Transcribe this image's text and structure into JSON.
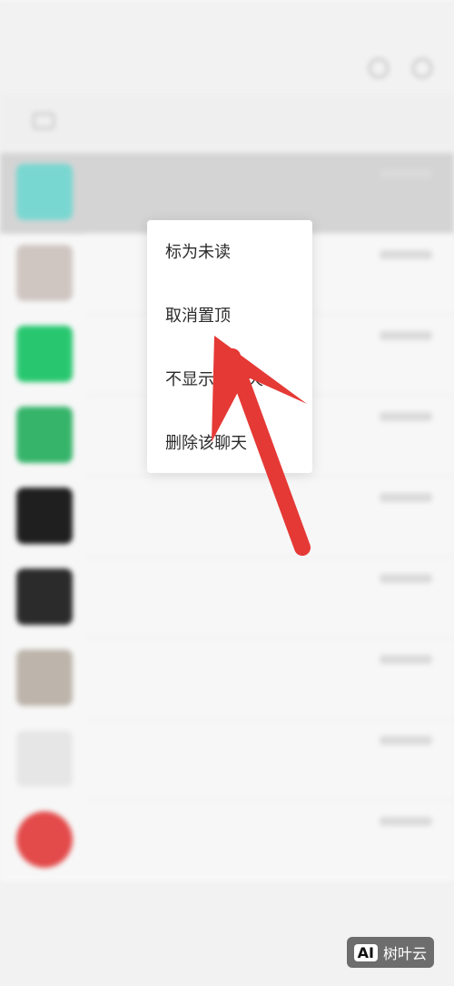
{
  "context_menu": {
    "items": [
      "标为未读",
      "取消置顶",
      "不显示该聊天",
      "删除该聊天"
    ]
  },
  "watermark": {
    "badge": "AI",
    "text": "树叶云"
  },
  "colors": {
    "arrow": "#e53935",
    "menu_background": "#ffffff",
    "pinned_row": "#d4d4d4",
    "nav_active": "#46c86a"
  }
}
